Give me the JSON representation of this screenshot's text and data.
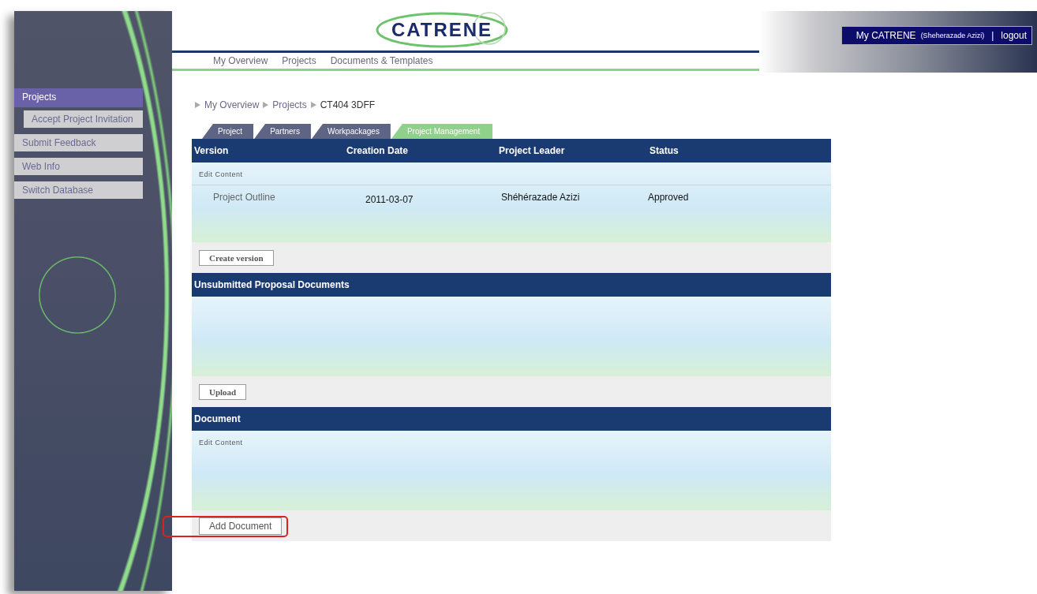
{
  "logo": {
    "text": "CATRENE"
  },
  "user_box": {
    "label": "My CATRENE",
    "user": "(Sheherazade Azizi)",
    "separator": "|",
    "logout": "logout"
  },
  "nav": {
    "items": [
      {
        "label": "My Overview"
      },
      {
        "label": "Projects"
      },
      {
        "label": "Documents & Templates"
      }
    ]
  },
  "sidebar": {
    "items": [
      {
        "label": "Projects",
        "selected": true,
        "children": [
          {
            "label": "Accept Project Invitation",
            "selected": false
          }
        ]
      },
      {
        "label": "Submit Feedback",
        "selected": false
      },
      {
        "label": "Web Info",
        "selected": false
      },
      {
        "label": "Switch Database",
        "selected": false
      }
    ]
  },
  "breadcrumb": [
    {
      "label": "My Overview",
      "link": true
    },
    {
      "label": "Projects",
      "link": true
    },
    {
      "label": "CT404 3DFF",
      "link": false
    }
  ],
  "tabs": [
    {
      "label": "Project",
      "selected": false
    },
    {
      "label": "Partners",
      "selected": false
    },
    {
      "label": "Workpackages",
      "selected": false
    },
    {
      "label": "Project Management",
      "selected": true
    }
  ],
  "sections": [
    {
      "kind": "table",
      "columns": [
        "Version",
        "Creation Date",
        "Project Leader",
        "Status"
      ],
      "note": "Edit Content",
      "rows": [
        [
          "Project Outline",
          "2011-03-07",
          "Shéhérazade Azizi",
          "Approved"
        ]
      ],
      "button": {
        "label": "Create version",
        "highlighted": false
      }
    },
    {
      "kind": "plain",
      "title": "Unsubmitted Proposal Documents",
      "button": {
        "label": "Upload",
        "highlighted": false
      }
    },
    {
      "kind": "plain",
      "title": "Document",
      "note": "Edit Content",
      "button": {
        "label": "Add Document",
        "highlighted": true
      }
    }
  ]
}
